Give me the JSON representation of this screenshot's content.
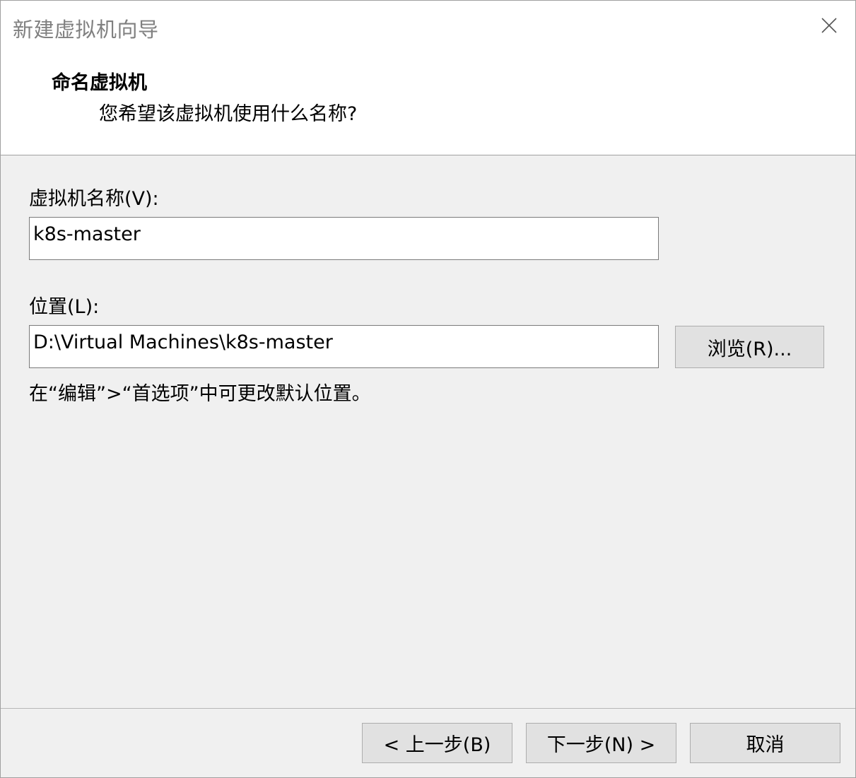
{
  "window": {
    "title": "新建虚拟机向导",
    "close_icon": "close-icon"
  },
  "header": {
    "title": "命名虚拟机",
    "subtitle": "您希望该虚拟机使用什么名称?"
  },
  "form": {
    "name_label": "虚拟机名称(V):",
    "name_value": "k8s-master",
    "location_label": "位置(L):",
    "location_value": "D:\\Virtual Machines\\k8s-master",
    "browse_label": "浏览(R)...",
    "hint": "在“编辑”>“首选项”中可更改默认位置。"
  },
  "footer": {
    "back_label": "< 上一步(B)",
    "next_label": "下一步(N) >",
    "cancel_label": "取消"
  }
}
